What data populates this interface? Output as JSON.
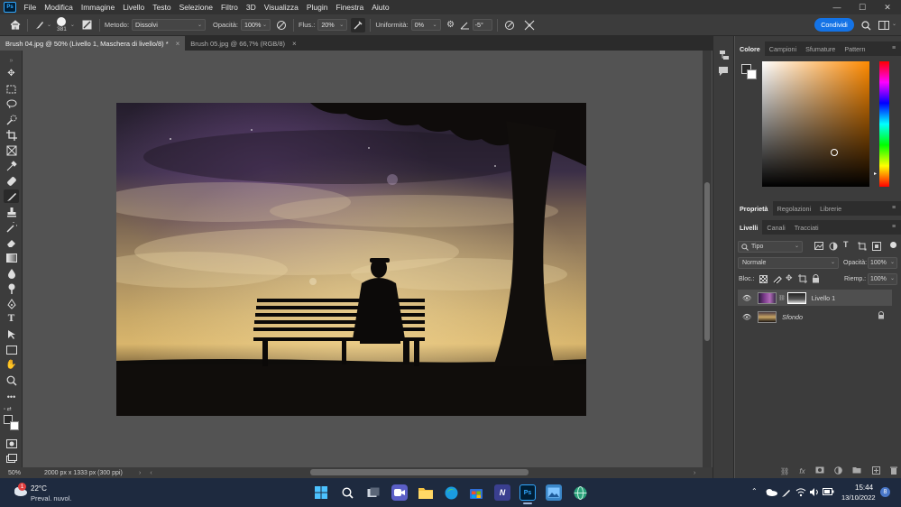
{
  "menu": {
    "items": [
      "File",
      "Modifica",
      "Immagine",
      "Livello",
      "Testo",
      "Selezione",
      "Filtro",
      "3D",
      "Visualizza",
      "Plugin",
      "Finestra",
      "Aiuto"
    ],
    "minimize": "—",
    "maximize": "☐",
    "close": "✕"
  },
  "options": {
    "brush_size": "381",
    "method_label": "Metodo:",
    "method_value": "Dissolvi",
    "opacity_label": "Opacità:",
    "opacity_value": "100%",
    "flow_label": "Flus.:",
    "flow_value": "20%",
    "smooth_label": "Uniformità:",
    "smooth_value": "0%",
    "angle_value": "-5°",
    "share_label": "Condividi"
  },
  "tabs": [
    {
      "label": "Brush 04.jpg @ 50% (Livello 1, Maschera di livello/8) *",
      "close": "×"
    },
    {
      "label": "Brush 05.jpg @ 66,7% (RGB/8)",
      "close": "×"
    }
  ],
  "status": {
    "zoom": "50%",
    "doc_info": "2000 px x 1333 px (300 ppi)"
  },
  "panels": {
    "color_tabs": [
      "Colore",
      "Campioni",
      "Sfumature",
      "Pattern"
    ],
    "props_tabs": [
      "Proprietà",
      "Regolazioni",
      "Librerie"
    ],
    "layer_tabs": [
      "Livelli",
      "Canali",
      "Tracciati"
    ],
    "filter_label": "Tipo",
    "blend_mode": "Normale",
    "opacity_label": "Opacità:",
    "opacity_value": "100%",
    "lock_label": "Bloc.:",
    "fill_label": "Riemp.:",
    "fill_value": "100%",
    "layers": [
      {
        "name": "Livello 1",
        "selected": true
      },
      {
        "name": "Sfondo",
        "selected": false
      }
    ]
  },
  "taskbar": {
    "temp": "22°C",
    "weather": "Preval. nuvol.",
    "badge": "1",
    "time": "15:44",
    "date": "13/10/2022",
    "notif": "8"
  },
  "colors": {
    "accent": "#1473e6",
    "panel_bg": "#3c3c3c",
    "canvas_bg": "#535353",
    "taskbar": "#1e2a3f"
  }
}
